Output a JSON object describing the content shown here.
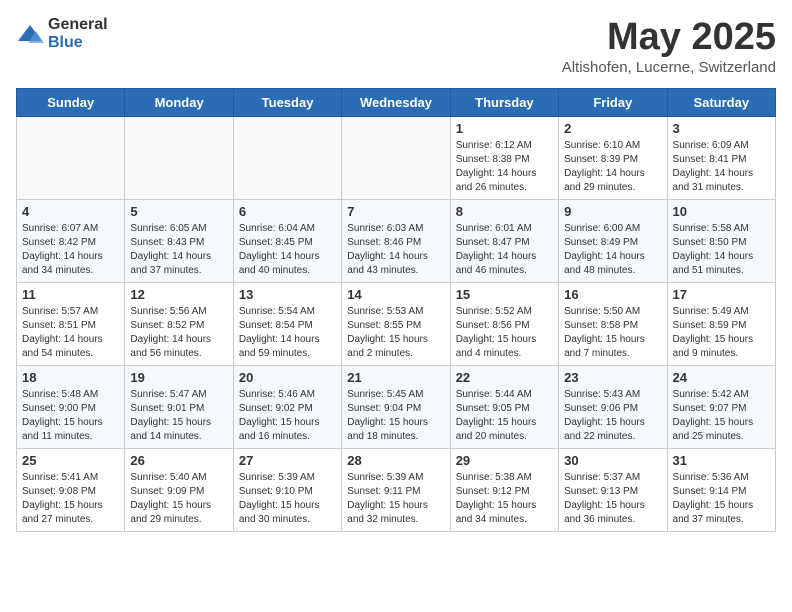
{
  "logo": {
    "text_general": "General",
    "text_blue": "Blue"
  },
  "title": "May 2025",
  "subtitle": "Altishofen, Lucerne, Switzerland",
  "days_of_week": [
    "Sunday",
    "Monday",
    "Tuesday",
    "Wednesday",
    "Thursday",
    "Friday",
    "Saturday"
  ],
  "weeks": [
    [
      {
        "day": null,
        "info": null
      },
      {
        "day": null,
        "info": null
      },
      {
        "day": null,
        "info": null
      },
      {
        "day": null,
        "info": null
      },
      {
        "day": "1",
        "info": "Sunrise: 6:12 AM\nSunset: 8:38 PM\nDaylight: 14 hours\nand 26 minutes."
      },
      {
        "day": "2",
        "info": "Sunrise: 6:10 AM\nSunset: 8:39 PM\nDaylight: 14 hours\nand 29 minutes."
      },
      {
        "day": "3",
        "info": "Sunrise: 6:09 AM\nSunset: 8:41 PM\nDaylight: 14 hours\nand 31 minutes."
      }
    ],
    [
      {
        "day": "4",
        "info": "Sunrise: 6:07 AM\nSunset: 8:42 PM\nDaylight: 14 hours\nand 34 minutes."
      },
      {
        "day": "5",
        "info": "Sunrise: 6:05 AM\nSunset: 8:43 PM\nDaylight: 14 hours\nand 37 minutes."
      },
      {
        "day": "6",
        "info": "Sunrise: 6:04 AM\nSunset: 8:45 PM\nDaylight: 14 hours\nand 40 minutes."
      },
      {
        "day": "7",
        "info": "Sunrise: 6:03 AM\nSunset: 8:46 PM\nDaylight: 14 hours\nand 43 minutes."
      },
      {
        "day": "8",
        "info": "Sunrise: 6:01 AM\nSunset: 8:47 PM\nDaylight: 14 hours\nand 46 minutes."
      },
      {
        "day": "9",
        "info": "Sunrise: 6:00 AM\nSunset: 8:49 PM\nDaylight: 14 hours\nand 48 minutes."
      },
      {
        "day": "10",
        "info": "Sunrise: 5:58 AM\nSunset: 8:50 PM\nDaylight: 14 hours\nand 51 minutes."
      }
    ],
    [
      {
        "day": "11",
        "info": "Sunrise: 5:57 AM\nSunset: 8:51 PM\nDaylight: 14 hours\nand 54 minutes."
      },
      {
        "day": "12",
        "info": "Sunrise: 5:56 AM\nSunset: 8:52 PM\nDaylight: 14 hours\nand 56 minutes."
      },
      {
        "day": "13",
        "info": "Sunrise: 5:54 AM\nSunset: 8:54 PM\nDaylight: 14 hours\nand 59 minutes."
      },
      {
        "day": "14",
        "info": "Sunrise: 5:53 AM\nSunset: 8:55 PM\nDaylight: 15 hours\nand 2 minutes."
      },
      {
        "day": "15",
        "info": "Sunrise: 5:52 AM\nSunset: 8:56 PM\nDaylight: 15 hours\nand 4 minutes."
      },
      {
        "day": "16",
        "info": "Sunrise: 5:50 AM\nSunset: 8:58 PM\nDaylight: 15 hours\nand 7 minutes."
      },
      {
        "day": "17",
        "info": "Sunrise: 5:49 AM\nSunset: 8:59 PM\nDaylight: 15 hours\nand 9 minutes."
      }
    ],
    [
      {
        "day": "18",
        "info": "Sunrise: 5:48 AM\nSunset: 9:00 PM\nDaylight: 15 hours\nand 11 minutes."
      },
      {
        "day": "19",
        "info": "Sunrise: 5:47 AM\nSunset: 9:01 PM\nDaylight: 15 hours\nand 14 minutes."
      },
      {
        "day": "20",
        "info": "Sunrise: 5:46 AM\nSunset: 9:02 PM\nDaylight: 15 hours\nand 16 minutes."
      },
      {
        "day": "21",
        "info": "Sunrise: 5:45 AM\nSunset: 9:04 PM\nDaylight: 15 hours\nand 18 minutes."
      },
      {
        "day": "22",
        "info": "Sunrise: 5:44 AM\nSunset: 9:05 PM\nDaylight: 15 hours\nand 20 minutes."
      },
      {
        "day": "23",
        "info": "Sunrise: 5:43 AM\nSunset: 9:06 PM\nDaylight: 15 hours\nand 22 minutes."
      },
      {
        "day": "24",
        "info": "Sunrise: 5:42 AM\nSunset: 9:07 PM\nDaylight: 15 hours\nand 25 minutes."
      }
    ],
    [
      {
        "day": "25",
        "info": "Sunrise: 5:41 AM\nSunset: 9:08 PM\nDaylight: 15 hours\nand 27 minutes."
      },
      {
        "day": "26",
        "info": "Sunrise: 5:40 AM\nSunset: 9:09 PM\nDaylight: 15 hours\nand 29 minutes."
      },
      {
        "day": "27",
        "info": "Sunrise: 5:39 AM\nSunset: 9:10 PM\nDaylight: 15 hours\nand 30 minutes."
      },
      {
        "day": "28",
        "info": "Sunrise: 5:39 AM\nSunset: 9:11 PM\nDaylight: 15 hours\nand 32 minutes."
      },
      {
        "day": "29",
        "info": "Sunrise: 5:38 AM\nSunset: 9:12 PM\nDaylight: 15 hours\nand 34 minutes."
      },
      {
        "day": "30",
        "info": "Sunrise: 5:37 AM\nSunset: 9:13 PM\nDaylight: 15 hours\nand 36 minutes."
      },
      {
        "day": "31",
        "info": "Sunrise: 5:36 AM\nSunset: 9:14 PM\nDaylight: 15 hours\nand 37 minutes."
      }
    ]
  ]
}
